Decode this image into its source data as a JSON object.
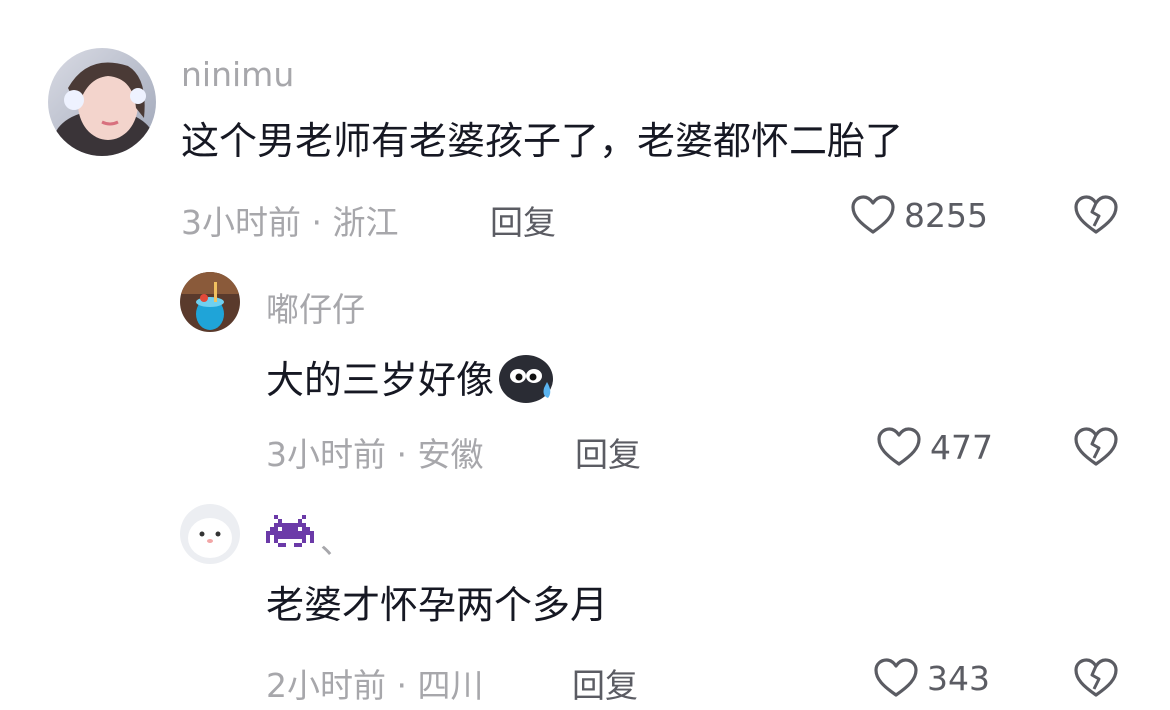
{
  "comments": [
    {
      "username": "ninimu",
      "text": "这个男老师有老婆孩子了，老婆都怀二胎了",
      "meta": "3小时前 · 浙江",
      "reply_label": "回复",
      "likes": "8255"
    },
    {
      "username": "嘟仔仔",
      "text": "大的三岁好像",
      "emoji": "sweat-face-emoji",
      "meta": "3小时前 · 安徽",
      "reply_label": "回复",
      "likes": "477"
    },
    {
      "username_suffix": "、",
      "username_emoji": "space-invader-emoji",
      "text": "老婆才怀孕两个多月",
      "meta": "2小时前 · 四川",
      "reply_label": "回复",
      "likes": "343"
    }
  ],
  "colors": {
    "primary_text": "#161823",
    "secondary_text": "#a7a7ab",
    "action_text": "#5b5c63",
    "background": "#ffffff"
  }
}
